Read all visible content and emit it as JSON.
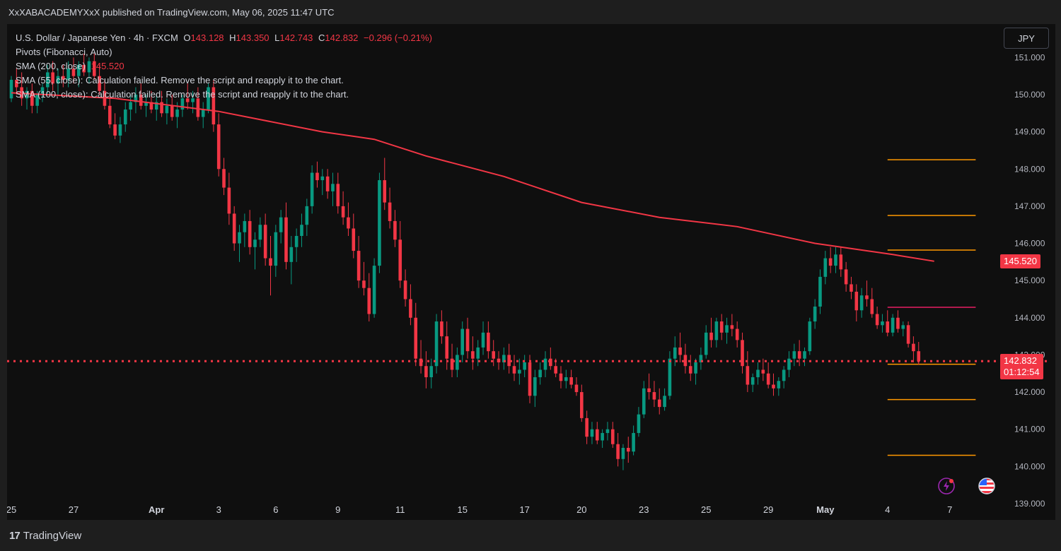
{
  "header": {
    "publisher_line": "XxXABACADEMYXxX published on TradingView.com, May 06, 2025 11:47 UTC"
  },
  "legend": {
    "symbol": "U.S. Dollar / Japanese Yen · 4h · FXCM",
    "open_label": "O",
    "open": "143.128",
    "high_label": "H",
    "high": "143.350",
    "low_label": "L",
    "low": "142.743",
    "close_label": "C",
    "close": "142.832",
    "change": "−0.296 (−0.21%)",
    "pivots": "Pivots (Fibonacci, Auto)",
    "sma200_label": "SMA (200, close)",
    "sma200_value": "145.520",
    "sma55": "SMA (55, close): Calculation failed. Remove the script and reapply it to the chart.",
    "sma100": "SMA (100, close): Calculation failed. Remove the script and reapply it to the chart."
  },
  "toolbar": {
    "currency": "JPY"
  },
  "badges": {
    "sma_value": "145.520",
    "last_price": "142.832",
    "countdown": "01:12:54"
  },
  "footer": {
    "brand": "TradingView",
    "brand_mark": "17"
  },
  "colors": {
    "background": "#0f0f0f",
    "up": "#089981",
    "down": "#f23645",
    "sma": "#f23645",
    "pivot": "#ff9800",
    "pivot_pp": "#e91e63",
    "text": "#d1d4dc"
  },
  "chart_data": {
    "type": "candlestick",
    "symbol": "USDJPY",
    "interval": "4h",
    "ylim": [
      138.6,
      151.9
    ],
    "y_ticks": [
      139,
      140,
      141,
      142,
      143,
      144,
      145,
      146,
      147,
      148,
      149,
      150,
      151
    ],
    "y_tick_labels": [
      "139.000",
      "140.000",
      "141.000",
      "142.000",
      "143.000",
      "144.000",
      "145.000",
      "146.000",
      "147.000",
      "148.000",
      "149.000",
      "150.000",
      "151.000"
    ],
    "x_ticks": [
      {
        "label": "25",
        "bar": 0
      },
      {
        "label": "27",
        "bar": 12
      },
      {
        "label": "Apr",
        "bar": 28,
        "bold": true
      },
      {
        "label": "3",
        "bar": 40
      },
      {
        "label": "6",
        "bar": 51
      },
      {
        "label": "9",
        "bar": 63
      },
      {
        "label": "11",
        "bar": 75
      },
      {
        "label": "15",
        "bar": 87
      },
      {
        "label": "17",
        "bar": 99
      },
      {
        "label": "20",
        "bar": 110
      },
      {
        "label": "23",
        "bar": 122
      },
      {
        "label": "25",
        "bar": 134
      },
      {
        "label": "29",
        "bar": 146
      },
      {
        "label": "May",
        "bar": 157,
        "bold": true
      },
      {
        "label": "4",
        "bar": 169
      },
      {
        "label": "7",
        "bar": 181
      }
    ],
    "candles": [
      [
        149.9,
        150.5,
        149.8,
        150.4
      ],
      [
        150.4,
        150.7,
        150.0,
        150.2
      ],
      [
        150.2,
        150.6,
        149.7,
        149.9
      ],
      [
        149.9,
        150.2,
        149.6,
        150.1
      ],
      [
        150.1,
        150.3,
        149.5,
        149.7
      ],
      [
        149.7,
        150.1,
        149.5,
        150.0
      ],
      [
        150.0,
        150.3,
        149.8,
        150.2
      ],
      [
        150.2,
        150.8,
        150.0,
        150.6
      ],
      [
        150.6,
        150.9,
        150.1,
        150.3
      ],
      [
        150.3,
        150.7,
        150.0,
        150.5
      ],
      [
        150.5,
        150.8,
        150.2,
        150.4
      ],
      [
        150.4,
        150.9,
        150.2,
        150.7
      ],
      [
        150.7,
        151.0,
        150.3,
        150.5
      ],
      [
        150.5,
        150.9,
        150.2,
        150.8
      ],
      [
        150.8,
        151.1,
        150.5,
        150.6
      ],
      [
        150.6,
        151.0,
        150.3,
        150.9
      ],
      [
        150.9,
        151.1,
        150.4,
        150.5
      ],
      [
        150.5,
        150.8,
        150.0,
        150.1
      ],
      [
        150.1,
        150.4,
        149.6,
        149.7
      ],
      [
        149.7,
        150.0,
        149.1,
        149.2
      ],
      [
        149.2,
        149.5,
        148.8,
        148.9
      ],
      [
        148.9,
        149.4,
        148.7,
        149.2
      ],
      [
        149.2,
        149.8,
        149.0,
        149.6
      ],
      [
        149.6,
        150.0,
        149.3,
        149.8
      ],
      [
        149.8,
        150.2,
        149.5,
        150.0
      ],
      [
        150.0,
        150.3,
        149.6,
        149.7
      ],
      [
        149.7,
        150.0,
        149.4,
        149.8
      ],
      [
        149.8,
        150.1,
        149.5,
        149.6
      ],
      [
        149.6,
        150.0,
        149.3,
        149.8
      ],
      [
        149.8,
        150.1,
        149.4,
        149.5
      ],
      [
        149.5,
        149.9,
        149.2,
        149.7
      ],
      [
        149.7,
        150.0,
        149.3,
        149.4
      ],
      [
        149.4,
        149.8,
        149.1,
        149.6
      ],
      [
        149.6,
        150.0,
        149.4,
        149.9
      ],
      [
        149.9,
        150.3,
        149.6,
        149.8
      ],
      [
        149.8,
        150.1,
        149.5,
        149.9
      ],
      [
        149.9,
        150.2,
        149.3,
        149.4
      ],
      [
        149.4,
        149.8,
        149.1,
        149.6
      ],
      [
        149.6,
        150.3,
        149.5,
        150.2
      ],
      [
        150.2,
        150.4,
        149.0,
        149.2
      ],
      [
        149.2,
        149.5,
        147.8,
        148.0
      ],
      [
        148.0,
        148.3,
        147.3,
        147.5
      ],
      [
        147.5,
        147.9,
        146.5,
        146.8
      ],
      [
        146.8,
        147.0,
        145.8,
        146.0
      ],
      [
        146.0,
        146.5,
        145.5,
        146.3
      ],
      [
        146.3,
        146.8,
        145.9,
        146.6
      ],
      [
        146.6,
        146.9,
        145.7,
        145.9
      ],
      [
        145.9,
        146.3,
        145.3,
        146.1
      ],
      [
        146.1,
        146.7,
        145.9,
        146.5
      ],
      [
        146.5,
        146.8,
        145.4,
        145.6
      ],
      [
        145.6,
        146.2,
        144.6,
        145.4
      ],
      [
        145.4,
        146.5,
        145.1,
        146.3
      ],
      [
        146.3,
        146.9,
        146.0,
        146.7
      ],
      [
        146.7,
        147.1,
        145.3,
        145.5
      ],
      [
        145.5,
        146.2,
        144.9,
        145.9
      ],
      [
        145.9,
        146.4,
        145.5,
        146.2
      ],
      [
        146.2,
        146.8,
        145.9,
        146.5
      ],
      [
        146.5,
        147.2,
        146.2,
        147.0
      ],
      [
        147.0,
        148.1,
        146.8,
        147.9
      ],
      [
        147.9,
        148.2,
        147.5,
        147.7
      ],
      [
        147.7,
        148.0,
        147.3,
        147.8
      ],
      [
        147.8,
        148.0,
        147.2,
        147.4
      ],
      [
        147.4,
        147.9,
        147.0,
        147.6
      ],
      [
        147.6,
        147.9,
        146.8,
        147.0
      ],
      [
        147.0,
        147.4,
        146.5,
        146.7
      ],
      [
        146.7,
        147.1,
        146.2,
        146.4
      ],
      [
        146.4,
        146.8,
        145.6,
        145.8
      ],
      [
        145.8,
        146.2,
        144.8,
        145.0
      ],
      [
        145.0,
        145.5,
        144.6,
        144.8
      ],
      [
        144.8,
        145.2,
        143.9,
        144.1
      ],
      [
        144.1,
        145.6,
        144.0,
        145.4
      ],
      [
        145.4,
        147.9,
        145.2,
        147.7
      ],
      [
        147.7,
        148.3,
        146.9,
        147.1
      ],
      [
        147.1,
        147.5,
        146.4,
        146.6
      ],
      [
        146.6,
        146.9,
        145.9,
        146.1
      ],
      [
        146.1,
        146.6,
        144.8,
        145.0
      ],
      [
        145.0,
        145.3,
        144.3,
        144.5
      ],
      [
        144.5,
        144.9,
        143.8,
        144.0
      ],
      [
        144.0,
        144.4,
        142.7,
        142.9
      ],
      [
        142.9,
        143.4,
        142.5,
        142.7
      ],
      [
        142.7,
        143.1,
        142.1,
        142.4
      ],
      [
        142.4,
        142.9,
        142.1,
        142.7
      ],
      [
        142.7,
        144.1,
        142.5,
        143.9
      ],
      [
        143.9,
        144.2,
        143.3,
        143.5
      ],
      [
        143.5,
        143.9,
        142.6,
        142.9
      ],
      [
        142.9,
        143.3,
        142.4,
        142.6
      ],
      [
        142.6,
        143.2,
        142.4,
        143.0
      ],
      [
        143.0,
        143.9,
        142.8,
        143.7
      ],
      [
        143.7,
        144.0,
        142.9,
        143.1
      ],
      [
        143.1,
        143.5,
        142.6,
        142.9
      ],
      [
        142.9,
        143.4,
        142.7,
        143.2
      ],
      [
        143.2,
        143.9,
        143.0,
        143.6
      ],
      [
        143.6,
        143.9,
        142.9,
        143.1
      ],
      [
        143.1,
        143.4,
        142.7,
        142.9
      ],
      [
        142.9,
        143.1,
        142.6,
        142.8
      ],
      [
        142.8,
        143.2,
        142.6,
        143.0
      ],
      [
        143.0,
        143.3,
        142.5,
        142.7
      ],
      [
        142.7,
        143.0,
        142.3,
        142.5
      ],
      [
        142.5,
        142.9,
        142.2,
        142.6
      ],
      [
        142.6,
        143.0,
        142.4,
        142.8
      ],
      [
        142.8,
        143.0,
        141.7,
        141.9
      ],
      [
        141.9,
        142.6,
        141.6,
        142.4
      ],
      [
        142.4,
        142.8,
        142.2,
        142.6
      ],
      [
        142.6,
        143.1,
        142.4,
        142.9
      ],
      [
        142.9,
        143.2,
        142.6,
        142.7
      ],
      [
        142.7,
        142.9,
        142.4,
        142.5
      ],
      [
        142.5,
        142.7,
        142.1,
        142.3
      ],
      [
        142.3,
        142.6,
        142.1,
        142.4
      ],
      [
        142.4,
        142.6,
        142.1,
        142.2
      ],
      [
        142.2,
        142.4,
        141.9,
        142.0
      ],
      [
        142.0,
        142.2,
        141.2,
        141.3
      ],
      [
        141.3,
        141.5,
        140.6,
        140.8
      ],
      [
        140.8,
        141.2,
        140.6,
        141.0
      ],
      [
        141.0,
        141.2,
        140.6,
        140.7
      ],
      [
        140.7,
        141.0,
        140.5,
        140.9
      ],
      [
        140.9,
        141.2,
        140.7,
        141.0
      ],
      [
        141.0,
        141.2,
        140.5,
        140.6
      ],
      [
        140.6,
        140.9,
        140.0,
        140.2
      ],
      [
        140.2,
        140.6,
        139.9,
        140.5
      ],
      [
        140.5,
        140.8,
        140.1,
        140.4
      ],
      [
        140.4,
        141.1,
        140.3,
        140.9
      ],
      [
        140.9,
        141.6,
        140.8,
        141.4
      ],
      [
        141.4,
        142.3,
        141.3,
        142.1
      ],
      [
        142.1,
        142.5,
        141.8,
        142.0
      ],
      [
        142.0,
        142.3,
        141.6,
        141.8
      ],
      [
        141.8,
        142.1,
        141.4,
        141.6
      ],
      [
        141.6,
        142.1,
        141.5,
        141.9
      ],
      [
        141.9,
        143.1,
        141.8,
        142.9
      ],
      [
        142.9,
        143.5,
        142.7,
        143.2
      ],
      [
        143.2,
        143.6,
        142.8,
        143.0
      ],
      [
        143.0,
        143.3,
        142.5,
        142.7
      ],
      [
        142.7,
        143.0,
        142.3,
        142.5
      ],
      [
        142.5,
        142.9,
        142.2,
        142.8
      ],
      [
        142.8,
        143.2,
        142.6,
        143.0
      ],
      [
        143.0,
        143.8,
        142.9,
        143.6
      ],
      [
        143.6,
        144.0,
        143.2,
        143.4
      ],
      [
        143.4,
        144.0,
        143.2,
        143.9
      ],
      [
        143.9,
        144.1,
        143.4,
        143.6
      ],
      [
        143.6,
        144.0,
        143.3,
        143.8
      ],
      [
        143.8,
        144.1,
        143.5,
        143.7
      ],
      [
        143.7,
        143.9,
        143.2,
        143.4
      ],
      [
        143.4,
        143.6,
        142.5,
        142.7
      ],
      [
        142.7,
        143.1,
        142.0,
        142.2
      ],
      [
        142.2,
        142.5,
        142.0,
        142.4
      ],
      [
        142.4,
        142.8,
        142.2,
        142.6
      ],
      [
        142.6,
        142.9,
        142.3,
        142.5
      ],
      [
        142.5,
        142.8,
        142.1,
        142.2
      ],
      [
        142.2,
        142.5,
        141.9,
        142.1
      ],
      [
        142.1,
        142.4,
        141.9,
        142.3
      ],
      [
        142.3,
        142.7,
        142.1,
        142.6
      ],
      [
        142.6,
        143.1,
        142.4,
        142.9
      ],
      [
        142.9,
        143.3,
        142.7,
        143.1
      ],
      [
        143.1,
        143.4,
        142.7,
        142.9
      ],
      [
        142.9,
        143.2,
        142.7,
        143.1
      ],
      [
        143.1,
        144.0,
        143.0,
        143.9
      ],
      [
        143.9,
        144.5,
        143.7,
        144.3
      ],
      [
        144.3,
        145.3,
        144.1,
        145.1
      ],
      [
        145.1,
        145.8,
        144.9,
        145.6
      ],
      [
        145.6,
        145.9,
        145.2,
        145.4
      ],
      [
        145.4,
        145.9,
        145.2,
        145.7
      ],
      [
        145.7,
        145.9,
        145.1,
        145.3
      ],
      [
        145.3,
        145.5,
        144.7,
        144.9
      ],
      [
        144.9,
        145.1,
        144.5,
        144.7
      ],
      [
        144.7,
        144.9,
        143.9,
        144.2
      ],
      [
        144.2,
        144.8,
        144.0,
        144.6
      ],
      [
        144.6,
        145.0,
        144.3,
        144.5
      ],
      [
        144.5,
        144.8,
        144.0,
        144.1
      ],
      [
        144.1,
        144.3,
        143.7,
        143.8
      ],
      [
        143.8,
        144.1,
        143.6,
        143.9
      ],
      [
        143.9,
        144.2,
        143.5,
        143.6
      ],
      [
        143.6,
        144.1,
        143.5,
        144.0
      ],
      [
        144.0,
        144.2,
        143.6,
        143.7
      ],
      [
        143.7,
        143.9,
        143.5,
        143.8
      ],
      [
        143.8,
        143.9,
        143.2,
        143.3
      ],
      [
        143.3,
        143.5,
        142.8,
        143.1
      ],
      [
        143.1,
        143.35,
        142.74,
        142.83
      ]
    ],
    "sma200": {
      "label": "SMA (200, close)",
      "points": [
        [
          0,
          150.05
        ],
        [
          20,
          149.9
        ],
        [
          40,
          149.55
        ],
        [
          60,
          149.0
        ],
        [
          70,
          148.8
        ],
        [
          80,
          148.35
        ],
        [
          95,
          147.8
        ],
        [
          110,
          147.1
        ],
        [
          125,
          146.7
        ],
        [
          140,
          146.45
        ],
        [
          155,
          146.0
        ],
        [
          170,
          145.7
        ],
        [
          178,
          145.52
        ]
      ]
    },
    "pivots": [
      {
        "level": 148.25,
        "color": "#ff9800"
      },
      {
        "level": 146.75,
        "color": "#ff9800"
      },
      {
        "level": 145.82,
        "color": "#ff9800"
      },
      {
        "level": 144.28,
        "color": "#e91e63"
      },
      {
        "level": 142.75,
        "color": "#ff9800"
      },
      {
        "level": 141.8,
        "color": "#ff9800"
      },
      {
        "level": 140.3,
        "color": "#ff9800"
      }
    ],
    "pivot_start_bar": 169,
    "pivot_end_bar": 186,
    "last_price": 142.832
  }
}
